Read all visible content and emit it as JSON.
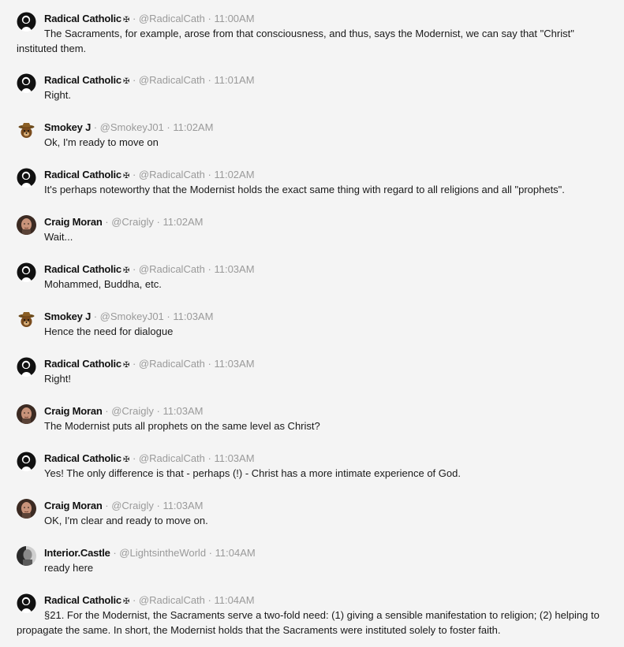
{
  "messages": [
    {
      "name": "Radical Catholic",
      "badge": "✠",
      "handle": "@RadicalCath",
      "time": "11:00AM",
      "avatar": "black-silhouette-avatar",
      "text": "The Sacraments, for example, arose from that consciousness, and thus, says the Modernist, we can say that \"Christ\" instituted them."
    },
    {
      "name": "Radical Catholic",
      "badge": "✠",
      "handle": "@RadicalCath",
      "time": "11:01AM",
      "avatar": "black-silhouette-avatar",
      "text": "Right."
    },
    {
      "name": "Smokey J",
      "badge": "",
      "handle": "@SmokeyJ01",
      "time": "11:02AM",
      "avatar": "bear-ranger-avatar",
      "text": "Ok, I'm ready to move on"
    },
    {
      "name": "Radical Catholic",
      "badge": "✠",
      "handle": "@RadicalCath",
      "time": "11:02AM",
      "avatar": "black-silhouette-avatar",
      "text": "It's perhaps noteworthy that the Modernist holds the exact same thing with regard to all religions and all \"prophets\"."
    },
    {
      "name": "Craig Moran",
      "badge": "",
      "handle": "@Craigly",
      "time": "11:02AM",
      "avatar": "man-photo-avatar",
      "text": "Wait..."
    },
    {
      "name": "Radical Catholic",
      "badge": "✠",
      "handle": "@RadicalCath",
      "time": "11:03AM",
      "avatar": "black-silhouette-avatar",
      "text": "Mohammed, Buddha, etc."
    },
    {
      "name": "Smokey J",
      "badge": "",
      "handle": "@SmokeyJ01",
      "time": "11:03AM",
      "avatar": "bear-ranger-avatar",
      "text": "Hence the need for dialogue"
    },
    {
      "name": "Radical Catholic",
      "badge": "✠",
      "handle": "@RadicalCath",
      "time": "11:03AM",
      "avatar": "black-silhouette-avatar",
      "text": "Right!"
    },
    {
      "name": "Craig Moran",
      "badge": "",
      "handle": "@Craigly",
      "time": "11:03AM",
      "avatar": "man-photo-avatar",
      "text": "The Modernist puts all prophets on the same level as Christ?"
    },
    {
      "name": "Radical Catholic",
      "badge": "✠",
      "handle": "@RadicalCath",
      "time": "11:03AM",
      "avatar": "black-silhouette-avatar",
      "text": "Yes! The only difference is that - perhaps (!) - Christ has a more intimate experience of God."
    },
    {
      "name": "Craig Moran",
      "badge": "",
      "handle": "@Craigly",
      "time": "11:03AM",
      "avatar": "man-photo-avatar",
      "text": "OK, I'm clear and ready to move on."
    },
    {
      "name": "Interior.Castle",
      "badge": "",
      "handle": "@LightsintheWorld",
      "time": "11:04AM",
      "avatar": "gray-portrait-avatar",
      "text": "ready here"
    },
    {
      "name": "Radical Catholic",
      "badge": "✠",
      "handle": "@RadicalCath",
      "time": "11:04AM",
      "avatar": "black-silhouette-avatar",
      "text": "§21. For the Modernist, the Sacraments serve a two-fold need: (1) giving a sensible manifestation to religion; (2) helping to propagate the same. In short, the Modernist holds that the Sacraments were instituted solely to foster faith."
    }
  ]
}
